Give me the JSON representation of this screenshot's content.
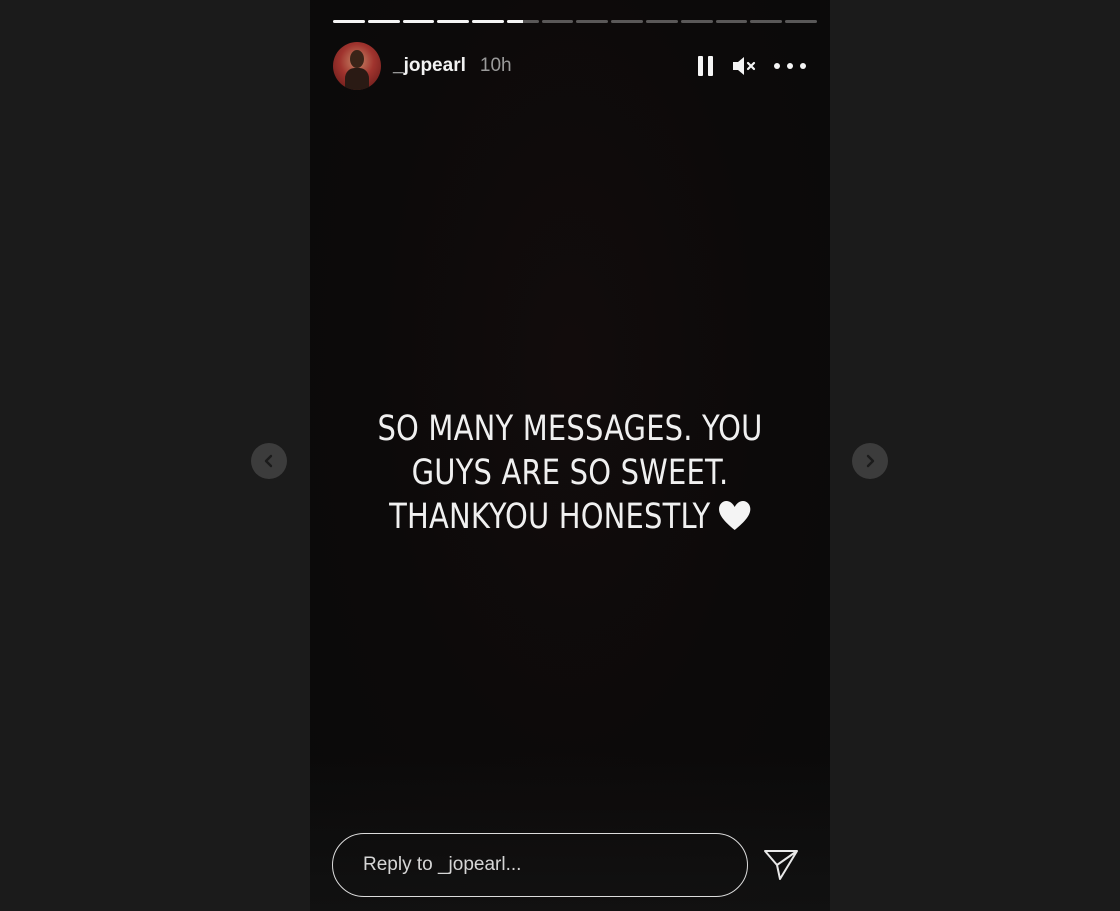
{
  "story": {
    "username": "_jopearl",
    "time": "10h",
    "segments": [
      1,
      1,
      1,
      1,
      1,
      0.5,
      0,
      0,
      0,
      0,
      0,
      0,
      0,
      0
    ],
    "message_lines": [
      "SO MANY MESSAGES. YOU",
      "GUYS ARE SO SWEET.",
      "THANKYOU HONESTLY"
    ],
    "message_emoji": "white-heart-icon"
  },
  "controls": {
    "pause_icon": "pause-icon",
    "mute_icon": "muted-speaker-icon",
    "more_icon": "more-options-icon"
  },
  "reply": {
    "placeholder": "Reply to _jopearl...",
    "send_icon": "send-icon"
  },
  "navigation": {
    "prev_icon": "chevron-left-icon",
    "next_icon": "chevron-right-icon"
  },
  "colors": {
    "page_background": "#1b1b1b",
    "story_background": "#0c0a0a",
    "text": "#f0f0f0",
    "muted_text": "#9a9a9a"
  }
}
